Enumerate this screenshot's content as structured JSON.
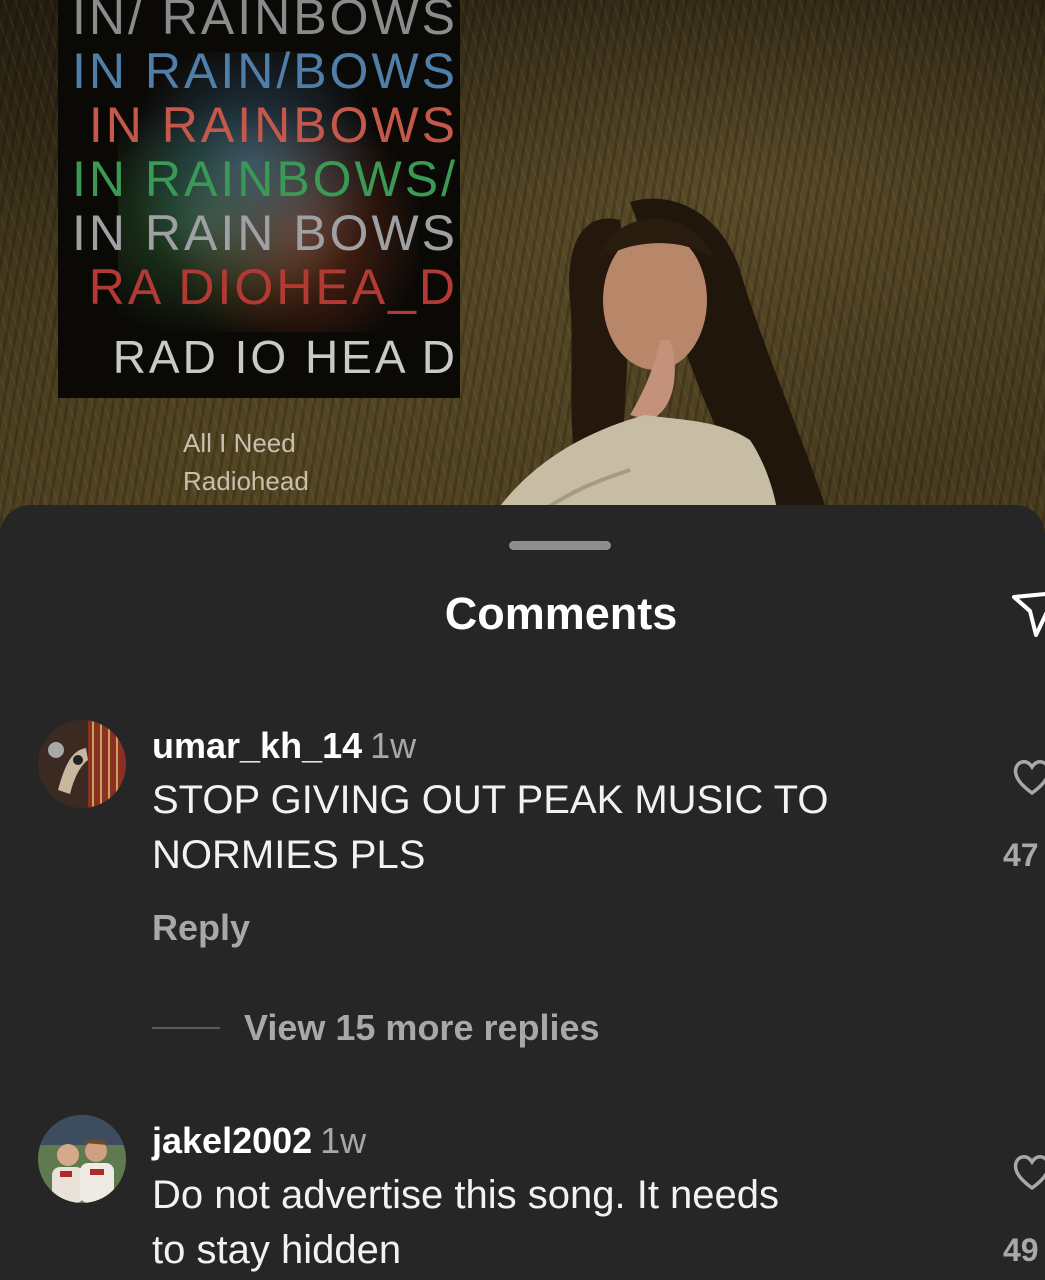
{
  "video": {
    "album_lines": [
      "IN/ RAINBOWS",
      "IN RAIN/BOWS",
      "IN RAINBOWS",
      "IN RAINBOWS/",
      "IN RAIN BOWS",
      "RA DIOHEA_D",
      "RAD IO HEA D"
    ],
    "song_title": "All I Need",
    "artist": "Radiohead"
  },
  "sheet": {
    "title": "Comments",
    "share_icon": "send-icon"
  },
  "comments": [
    {
      "username": "umar_kh_14",
      "time": "1w",
      "text_lines": [
        "STOP GIVING OUT PEAK MUSIC TO",
        "NORMIES PLS"
      ],
      "reply_label": "Reply",
      "more_replies_label": "View 15 more replies",
      "like_count": "47",
      "like_icon": "heart-icon"
    },
    {
      "username": "jakel2002",
      "time": "1w",
      "text_lines": [
        "Do not advertise this song. It needs",
        "to stay hidden"
      ],
      "like_count": "49",
      "like_icon": "heart-icon"
    }
  ],
  "colors": {
    "sheet_bg": "#262626",
    "text_primary": "#ffffff",
    "text_secondary": "#a8a8a8"
  }
}
